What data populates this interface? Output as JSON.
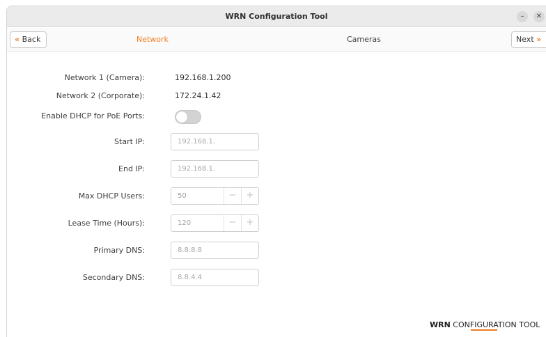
{
  "window": {
    "title": "WRN Configuration Tool",
    "minimize_glyph": "–",
    "close_glyph": "✕"
  },
  "nav": {
    "back_label": "Back",
    "back_icon": "«",
    "next_label": "Next",
    "next_icon": "»",
    "tabs": [
      {
        "label": "Network",
        "active": true
      },
      {
        "label": "Cameras",
        "active": false
      }
    ]
  },
  "info": [
    {
      "label": "Network 1 (Camera):",
      "value": "192.168.1.200"
    },
    {
      "label": "Network 2 (Corporate):",
      "value": "172.24.1.42"
    }
  ],
  "dhcp": {
    "label": "Enable DHCP for PoE Ports:",
    "enabled": false
  },
  "fields": {
    "start_ip": {
      "label": "Start IP:",
      "placeholder": "192.168.1."
    },
    "end_ip": {
      "label": "End IP:",
      "placeholder": "192.168.1."
    },
    "max_users": {
      "label": "Max DHCP Users:",
      "value": "50"
    },
    "lease_time": {
      "label": "Lease Time (Hours):",
      "value": "120"
    },
    "primary_dns": {
      "label": "Primary DNS:",
      "placeholder": "8.8.8.8"
    },
    "secondary_dns": {
      "label": "Secondary DNS:",
      "placeholder": "8.8.4.4"
    }
  },
  "stepper": {
    "minus": "−",
    "plus": "+"
  },
  "brand": {
    "bold": "WRN",
    "rest": " CONFIGURATION TOOL"
  },
  "colors": {
    "accent": "#ef7d22",
    "titlebar": "#ebebeb",
    "toggle_off": "#d3d3d3"
  }
}
